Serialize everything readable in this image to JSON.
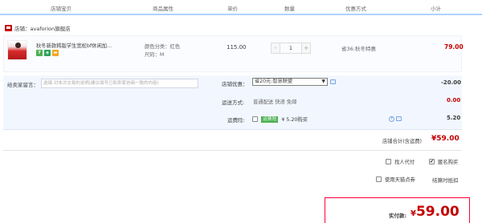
{
  "header": {
    "columns": [
      "店铺宝贝",
      "商品属性",
      "单价",
      "数量",
      "优惠方式",
      "小计"
    ]
  },
  "shop": {
    "name": "店铺：avaforion旗舰店"
  },
  "item": {
    "title": "秋冬新款韩版学生宽松bf休闲加...",
    "badges": [
      {
        "text": "7",
        "color": "#4bb04e"
      },
      {
        "text": "◈",
        "color": "#28a45a"
      },
      {
        "text": "▬",
        "color": "#f5a623"
      }
    ],
    "color_attr": "颜色分类：红色",
    "size_attr": "尺码：M",
    "price": "115.00",
    "quantity": "1",
    "minus": "-",
    "plus": "+",
    "promo": "省36:秋冬特惠",
    "subtotal": "79.00"
  },
  "options": {
    "message_label": "给卖家留言：",
    "message_placeholder": "选填:对本次交易的说明(建议填写已和卖家协商一致的内容)",
    "shop_discount_label": "店铺优惠：",
    "shop_discount_value": "省20元:智慧联盟",
    "shop_discount_amount": "-20.00",
    "shipping_label": "运送方式:",
    "shipping_value": "普通配送 快递 免邮",
    "shipping_amount": "0.00",
    "insurance_label": "运费险:",
    "insurance_badge": "运费险",
    "insurance_text": "¥ 5.20购买",
    "insurance_amount": "5.20"
  },
  "totals": {
    "shop_total_label": "店铺合计(含运费)",
    "shop_total": "¥59.00",
    "proxy_pay": "找人代付",
    "anonymous": "匿名购买",
    "tmall_points": "使用天猫点券",
    "settle": "结算时抵扣",
    "pay_label": "实付款:",
    "currency": "¥",
    "pay_amount": "59.00"
  },
  "colors": {
    "accent_red": "#c40000",
    "header_line": "#b2d1ff",
    "pay_border": "#ff0036"
  }
}
